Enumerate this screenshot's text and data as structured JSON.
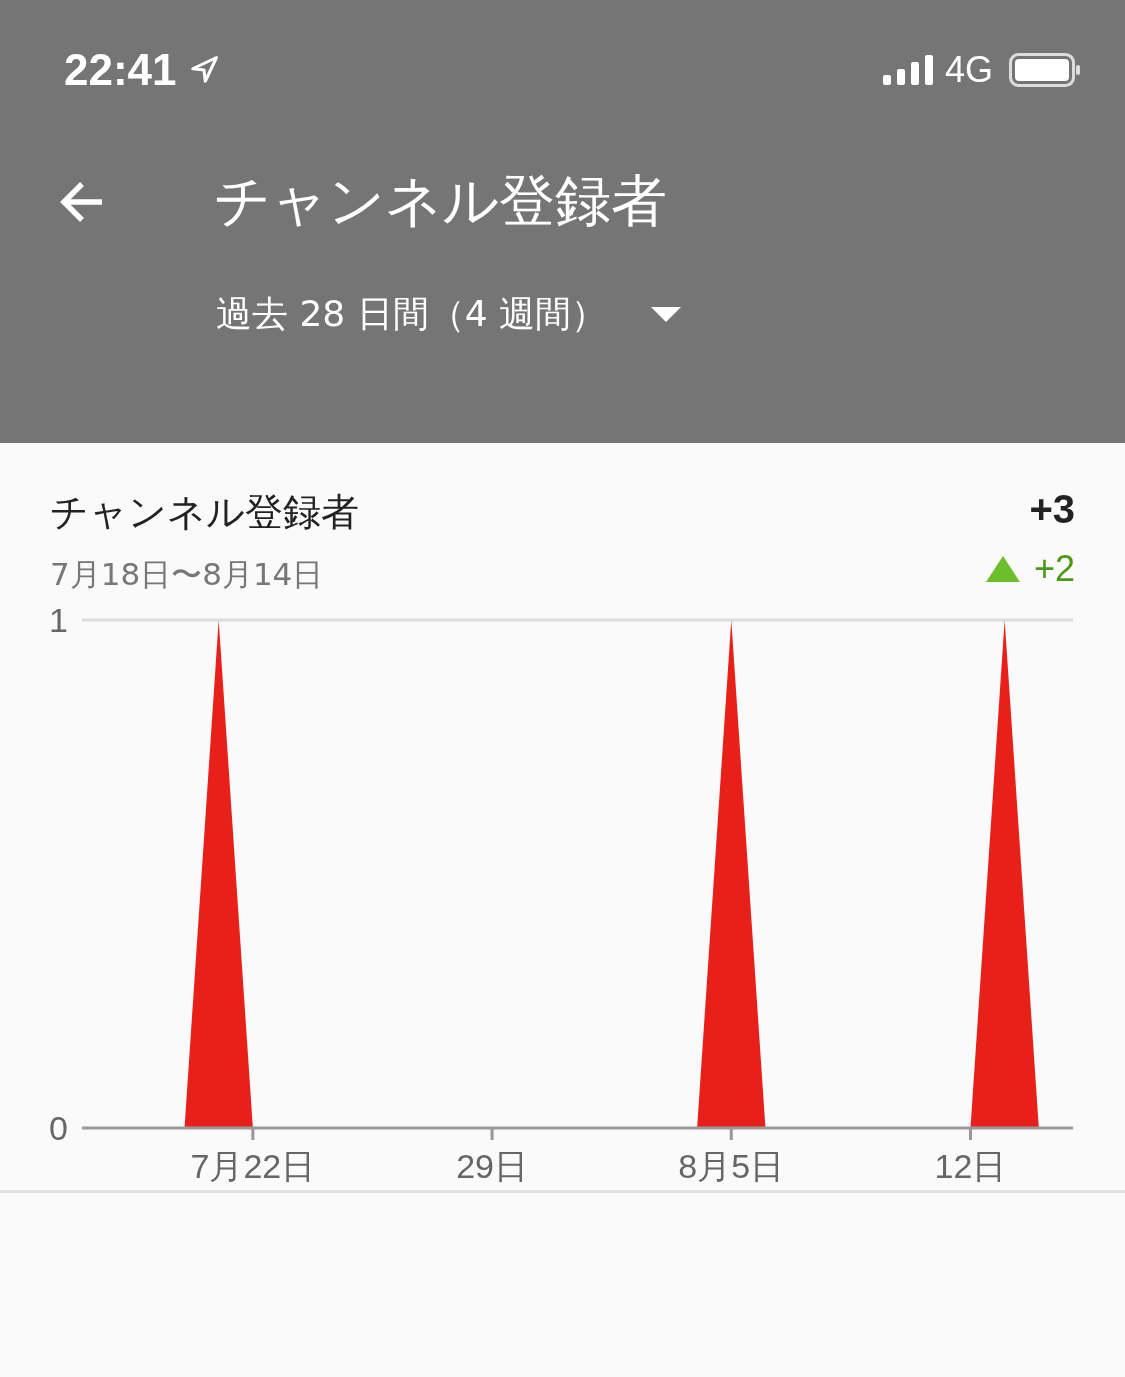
{
  "status_bar": {
    "time": "22:41",
    "network": "4G"
  },
  "header": {
    "title": "チャンネル登録者",
    "period": "過去 28 日間（4 週間）"
  },
  "card": {
    "title": "チャンネル登録者",
    "date_range": "7月18日〜8月14日",
    "total": "+3",
    "change": "+2",
    "chart_data": {
      "type": "area",
      "categories": [
        null,
        null,
        null,
        null,
        "7月22日",
        null,
        null,
        null,
        null,
        null,
        null,
        "29日",
        null,
        null,
        null,
        null,
        null,
        null,
        "8月5日",
        null,
        null,
        null,
        null,
        null,
        null,
        "12日",
        null,
        null
      ],
      "series": [
        {
          "color": "#e8201a",
          "values": [
            0,
            0,
            0,
            1,
            0,
            0,
            0,
            0,
            0,
            0,
            0,
            0,
            0,
            0,
            0,
            0,
            0,
            0,
            1,
            0,
            0,
            0,
            0,
            0,
            0,
            0,
            1,
            0
          ]
        }
      ],
      "ylim": [
        0,
        1
      ],
      "yticks": [
        0,
        1
      ]
    }
  }
}
